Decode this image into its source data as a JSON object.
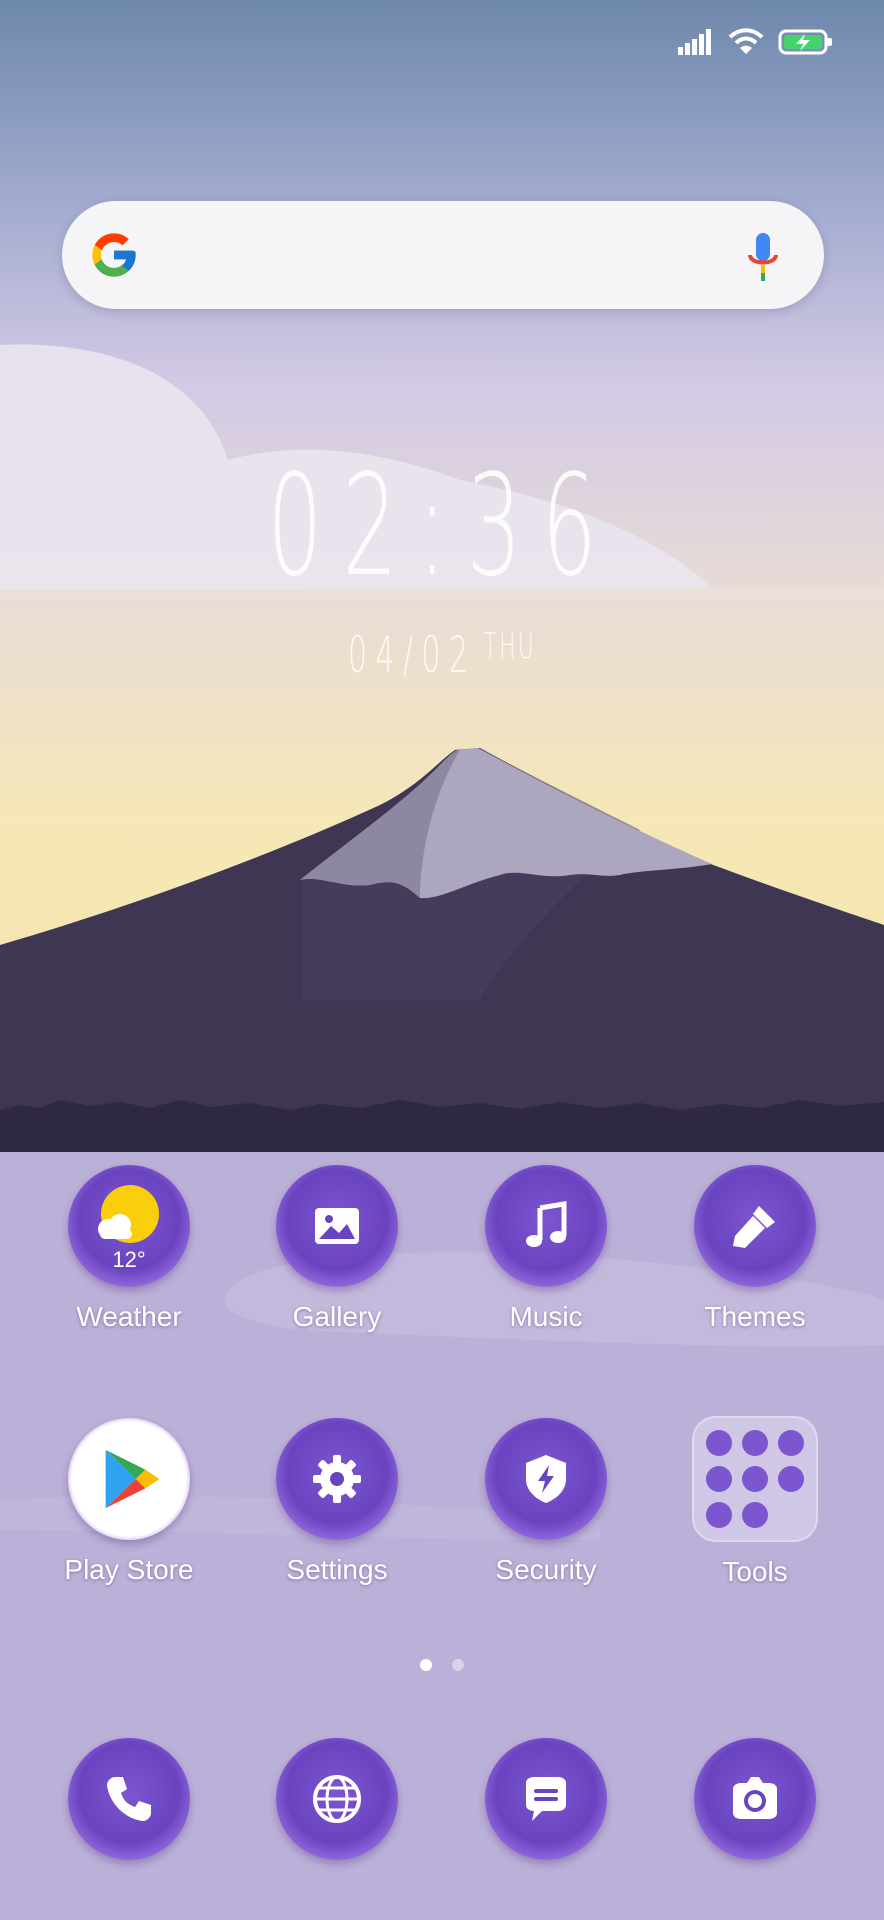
{
  "status_bar": {
    "icons": [
      "signal-icon",
      "wifi-icon",
      "battery-charging-icon"
    ]
  },
  "search": {
    "logo": "google-logo",
    "mic_icon": "mic-icon"
  },
  "clock": {
    "time": "02:36",
    "date": "04/02",
    "day": "THU"
  },
  "weather": {
    "temperature": "12°"
  },
  "apps_row1": [
    {
      "label": "Weather",
      "icon": "weather-icon"
    },
    {
      "label": "Gallery",
      "icon": "gallery-icon"
    },
    {
      "label": "Music",
      "icon": "music-icon"
    },
    {
      "label": "Themes",
      "icon": "brush-icon"
    }
  ],
  "apps_row2": [
    {
      "label": "Play Store",
      "icon": "play-store-icon"
    },
    {
      "label": "Settings",
      "icon": "gear-icon"
    },
    {
      "label": "Security",
      "icon": "shield-icon"
    },
    {
      "label": "Tools",
      "icon": "folder-icon"
    }
  ],
  "pager": {
    "pages": 2,
    "current": 1
  },
  "dock": [
    {
      "icon": "phone-icon"
    },
    {
      "icon": "browser-icon"
    },
    {
      "icon": "messages-icon"
    },
    {
      "icon": "camera-icon"
    }
  ],
  "colors": {
    "accent": "#6a44c0",
    "sun": "#f8cf0a",
    "mountain": "#3e3652"
  }
}
